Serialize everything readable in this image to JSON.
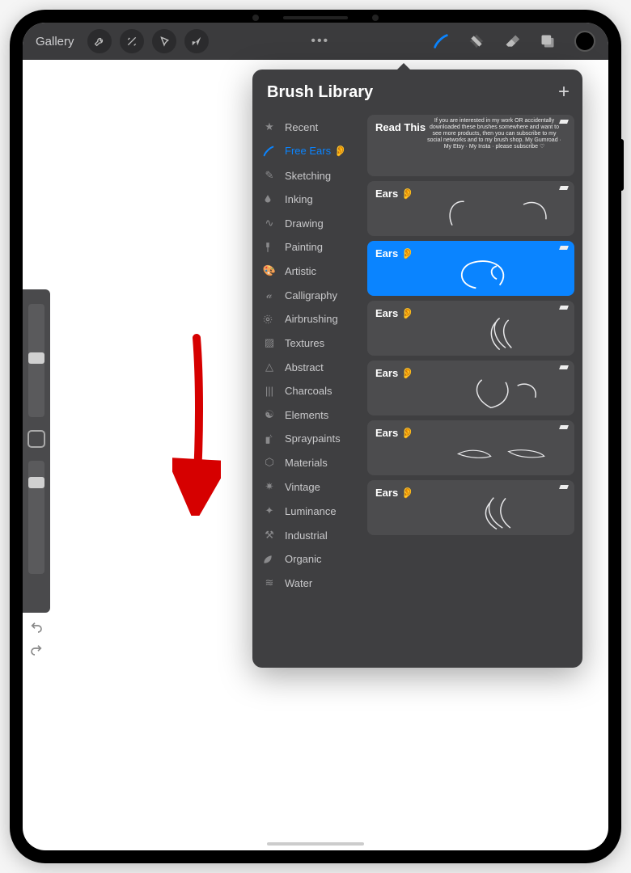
{
  "toolbar": {
    "gallery_label": "Gallery",
    "dots_label": "•••"
  },
  "popup": {
    "title": "Brush Library"
  },
  "categories": [
    {
      "label": "Recent",
      "icon": "★"
    },
    {
      "label": "Free Ears 👂",
      "icon": "brush",
      "selected": true
    },
    {
      "label": "Sketching",
      "icon": "✎"
    },
    {
      "label": "Inking",
      "icon": "ink"
    },
    {
      "label": "Drawing",
      "icon": "∿"
    },
    {
      "label": "Painting",
      "icon": "paint"
    },
    {
      "label": "Artistic",
      "icon": "🎨"
    },
    {
      "label": "Calligraphy",
      "icon": "𝒶"
    },
    {
      "label": "Airbrushing",
      "icon": "air"
    },
    {
      "label": "Textures",
      "icon": "▨"
    },
    {
      "label": "Abstract",
      "icon": "△"
    },
    {
      "label": "Charcoals",
      "icon": "|||"
    },
    {
      "label": "Elements",
      "icon": "☯"
    },
    {
      "label": "Spraypaints",
      "icon": "spray"
    },
    {
      "label": "Materials",
      "icon": "⬡"
    },
    {
      "label": "Vintage",
      "icon": "✷"
    },
    {
      "label": "Luminance",
      "icon": "✦"
    },
    {
      "label": "Industrial",
      "icon": "⚒"
    },
    {
      "label": "Organic",
      "icon": "leaf"
    },
    {
      "label": "Water",
      "icon": "≋"
    }
  ],
  "brushes": [
    {
      "label": "Read This",
      "special": "info"
    },
    {
      "label": "Ears 👂"
    },
    {
      "label": "Ears 👂",
      "selected": true
    },
    {
      "label": "Ears 👂"
    },
    {
      "label": "Ears 👂"
    },
    {
      "label": "Ears 👂"
    },
    {
      "label": "Ears 👂"
    }
  ],
  "info_text": "If you are interested in my work OR accidentally downloaded these brushes somewhere and want to see more products, then you can subscribe to my social networks and to my brush shop. My Gumroad · My Etsy · My Insta · please subscribe ♡"
}
